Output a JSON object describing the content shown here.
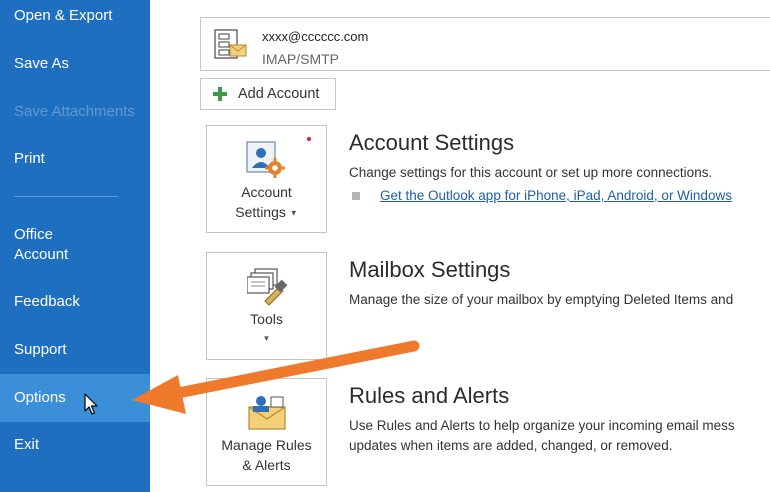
{
  "sidebar": {
    "items": [
      {
        "label": "Open & Export"
      },
      {
        "label": "Save As"
      },
      {
        "label": "Save Attachments"
      },
      {
        "label": "Print"
      },
      {
        "label": "Office"
      },
      {
        "label": "Account"
      },
      {
        "label": "Feedback"
      },
      {
        "label": "Support"
      },
      {
        "label": "Options"
      },
      {
        "label": "Exit"
      }
    ]
  },
  "account": {
    "email": "xxxx@cccccc.com",
    "type": "IMAP/SMTP",
    "add_label": "Add Account"
  },
  "sections": [
    {
      "card_line1": "Account",
      "card_line2": "Settings",
      "title": "Account Settings",
      "desc": "Change settings for this account or set up more connections.",
      "link": "Get the Outlook app for iPhone, iPad, Android, or Windows"
    },
    {
      "card_line1": "Tools",
      "title": "Mailbox Settings",
      "desc": "Manage the size of your mailbox by emptying Deleted Items and"
    },
    {
      "card_line1": "Manage Rules",
      "card_line2": "& Alerts",
      "title": "Rules and Alerts",
      "desc1": "Use Rules and Alerts to help organize your incoming email mess",
      "desc2": "updates when items are added, changed, or removed."
    }
  ],
  "colors": {
    "sidebar": "#1f6fc1",
    "sidebar_selected": "#3b8ed8",
    "arrow": "#f07a2c",
    "link": "#1e5fa8"
  }
}
